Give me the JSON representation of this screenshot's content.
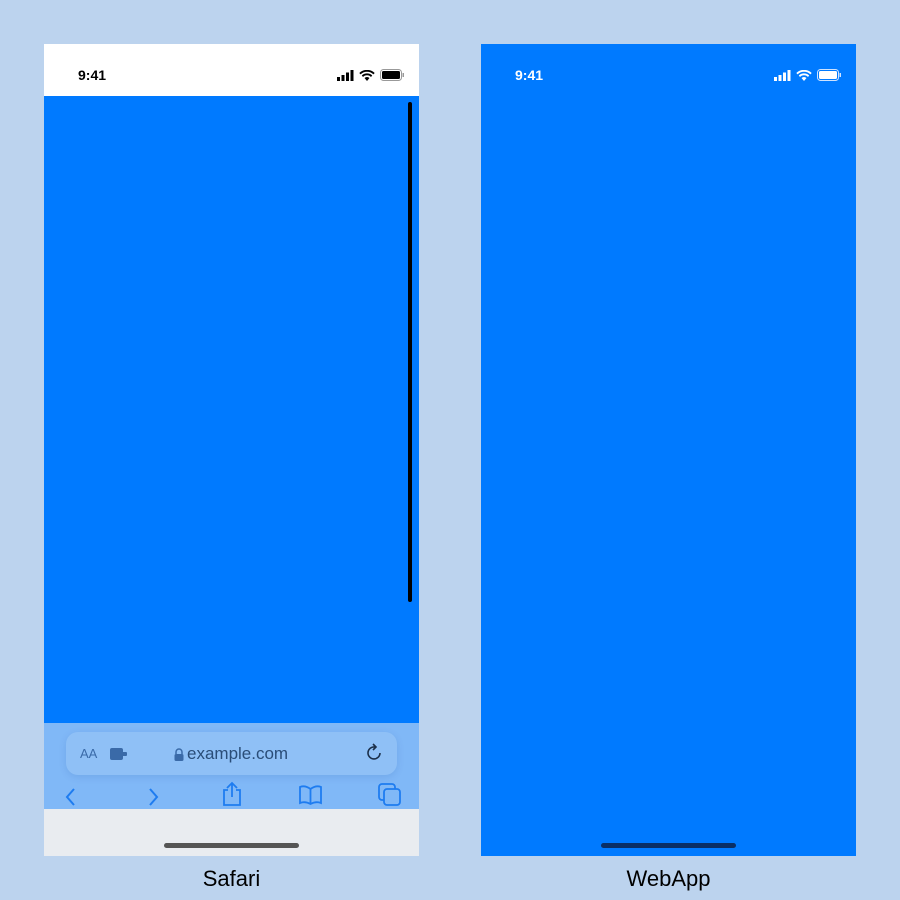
{
  "safari": {
    "time": "9:41",
    "aa": "AA",
    "url": "example.com",
    "label": "Safari"
  },
  "webapp": {
    "time": "9:41",
    "label": "WebApp"
  },
  "colors": {
    "page": "#007aff",
    "background": "#bcd3ee"
  }
}
